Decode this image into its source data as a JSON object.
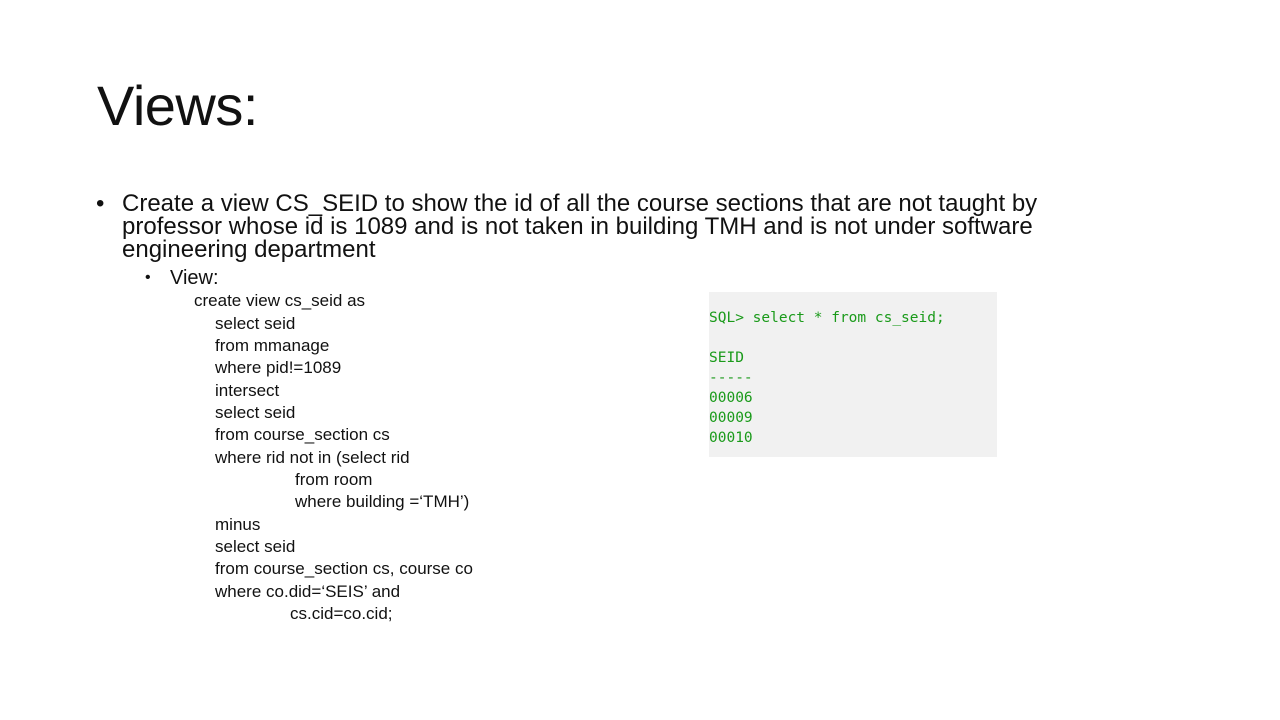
{
  "slide": {
    "title": "Views:",
    "bullet": {
      "line1": "Create a view CS_SEID to show the id of all the course sections that are not taught by",
      "line2": "professor whose id is 1089 and is not taken in building TMH and is not under software",
      "line3": "engineering department"
    },
    "sub_bullet": "View:",
    "code_lines": [
      "create view cs_seid as",
      "select seid",
      "from mmanage",
      "where pid!=1089",
      "intersect",
      "select seid",
      "from course_section cs",
      "where rid not in (select rid",
      "from room",
      "where building =‘TMH’)",
      "minus",
      "select seid",
      "from course_section cs, course co",
      "where co.did=‘SEIS’ and",
      "cs.cid=co.cid;"
    ]
  },
  "sql_output": {
    "query": "SQL> select * from cs_seid;",
    "column": "SEID",
    "separator": "-----",
    "rows": [
      "00006",
      "00009",
      "00010"
    ]
  },
  "colors": {
    "sql_text": "#1a9a1a",
    "sql_background": "#f1f1f1",
    "body_text": "#111111"
  }
}
